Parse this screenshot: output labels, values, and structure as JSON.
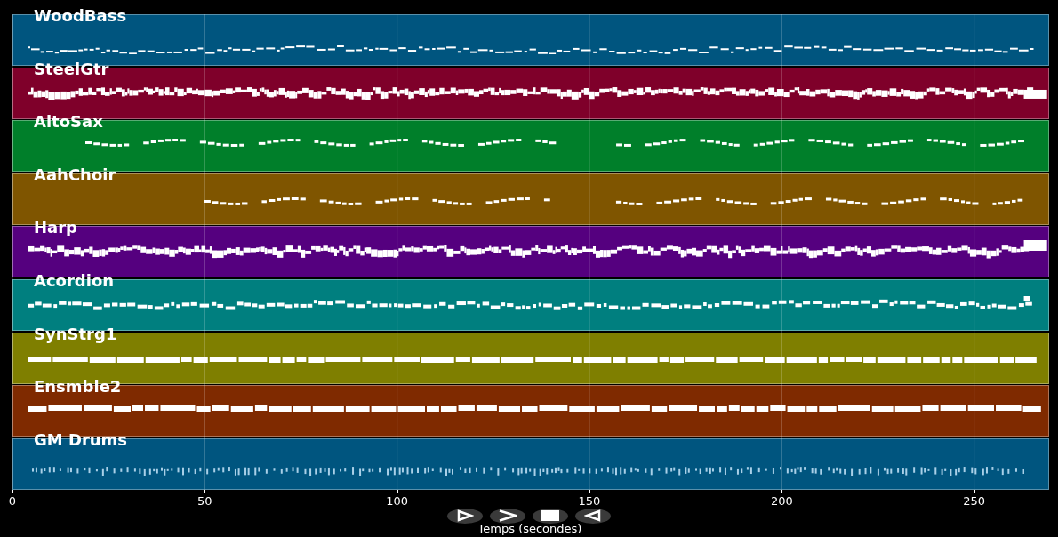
{
  "tracks": [
    {
      "name": "WoodBass",
      "color": "#00557f",
      "kind": "melodic"
    },
    {
      "name": "SteelGtr",
      "color": "#7f002a",
      "kind": "dense"
    },
    {
      "name": "AltoSax",
      "color": "#007f2a",
      "kind": "phrases"
    },
    {
      "name": "AahChoir",
      "color": "#7f5500",
      "kind": "phrases-late"
    },
    {
      "name": "Harp",
      "color": "#55007f",
      "kind": "dense"
    },
    {
      "name": "Acordion",
      "color": "#007f7f",
      "kind": "melodic"
    },
    {
      "name": "SynStrg1",
      "color": "#7f7f00",
      "kind": "sustained"
    },
    {
      "name": "Ensmble2",
      "color": "#7f2a00",
      "kind": "sustained"
    },
    {
      "name": "GM Drums",
      "color": "#00557f",
      "kind": "drums"
    }
  ],
  "x_axis": {
    "label": "Temps (secondes)",
    "ticks": [
      "0",
      "50",
      "100",
      "150",
      "200",
      "250"
    ]
  },
  "controls": [
    {
      "kind": "play"
    },
    {
      "kind": "forward"
    },
    {
      "kind": "stop"
    },
    {
      "kind": "back"
    }
  ]
}
